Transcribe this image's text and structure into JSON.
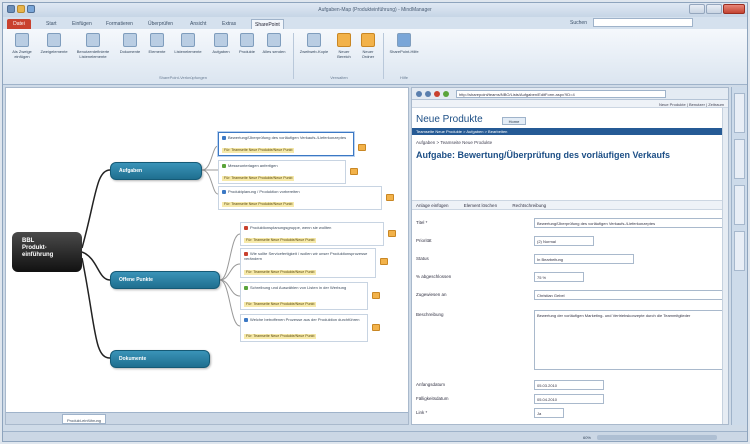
{
  "titlebar": {
    "title": "Aufgaben-Map (Produkteinführung) - MindManager"
  },
  "ribbon_tabs": [
    "Datei",
    "Start",
    "Einfügen",
    "Formatieren",
    "Überprüfen",
    "Ansicht",
    "Extras",
    "SharePoint"
  ],
  "active_tab_index": 7,
  "search": {
    "label": "Suchen",
    "value": ""
  },
  "ribbon": {
    "buttons": [
      "Als Zweige einfügen",
      "Zweigelemente",
      "Benutzerdefinierte Listenelemente",
      "Dokumente",
      "Elemente",
      "Listenelemente",
      "Aufgaben",
      "Produkte",
      "Alles senden",
      "Zweitweb-Kopie",
      "Neuer Bereich",
      "Neuer Ordner",
      "SharePoint-Hilfe"
    ],
    "groups": [
      "SharePoint-Verknüpfungen",
      "Verwalten",
      "Hilfe"
    ]
  },
  "map": {
    "central": {
      "line1": "BBL",
      "line2": "Produkt-",
      "line3": "einführung"
    },
    "topics": [
      "Aufgaben",
      "Offene Punkte",
      "Dokumente"
    ],
    "tasks": [
      {
        "text": "Bewertung/Überprüfung des vorläufigen Verkaufs-/Lieferkonzeptes",
        "tag": "Für: Teamseite Neue Produkte/Neue Punkt",
        "color": "#3b78c4"
      },
      {
        "text": "Messeunterlagen anfertigen",
        "tag": "Für: Teamseite Neue Produkte/Neue Punkt",
        "color": "#5aa43a"
      },
      {
        "text": "Produktplanung / Produktion vorbereiten",
        "tag": "Für: Teamseite Neue Produkte/Neue Punkt",
        "color": "#3b78c4"
      },
      {
        "text": "Produktionsplanungsgruppe, wenn sie wollten",
        "tag": "Für: Teamseite Neue Produkte/Neue Punkt",
        "color": "#c9412e"
      },
      {
        "text": "Wie sollte Servicefertigkeit / wollen wir unser Produktionsprozesse verändern",
        "tag": "Für: Teamseite Neue Produkte/Neue Punkt",
        "color": "#c9412e"
      },
      {
        "text": "Schreibung und Auswählen von Listen in der Werbung",
        "tag": "Für: Teamseite Neue Produkte/Neue Punkt",
        "color": "#5aa43a"
      },
      {
        "text": "Welche betroffenen Prozesse aus der Produktion durchführen",
        "tag": "Für: Teamseite Neue Produkte/Neue Punkt",
        "color": "#3b78c4"
      }
    ]
  },
  "status": {
    "doc_tab": "Produkt-einführung",
    "zoom": "60%"
  },
  "browser": {
    "url": "http://sharepoint/teams/NBO/Lists/Aufgaben/EditForm.aspx?ID=4",
    "bar2": "Neue Produkte | Benutzer | Zeitraum",
    "site_title": "Neue Produkte",
    "site_tab": "Home",
    "blue_bar": "Teamseite Neue Produkte > Aufgaben > Bearbeiten",
    "breadcrumb": "Aufgaben > Teamseite Neue Produkte",
    "heading_prefix": "Aufgabe:",
    "heading": "Bewertung/Überprüfung des vorläufigen Verkaufs",
    "toolbar": [
      "Anlage einfügen",
      "Element löschen",
      "Rechtschreibung"
    ],
    "fields": [
      {
        "label": "Titel *",
        "value": "Bewertung/Überprüfung des vorläufigen Verkaufs-/Lieferkonzeptes"
      },
      {
        "label": "Priorität",
        "value": "(2) Normal"
      },
      {
        "label": "Status",
        "value": "In Bearbeitung"
      },
      {
        "label": "% abgeschlossen",
        "value": "75 %"
      },
      {
        "label": "Zugewiesen an",
        "value": "Christian Gebel"
      },
      {
        "label": "Beschreibung",
        "value": "Bewertung der vorläufigen Marketing- und Vertriebskonzepte durch die Teammitglieder"
      },
      {
        "label": "Anfangsdatum",
        "value": "05.03.2010"
      },
      {
        "label": "Fälligkeitsdatum",
        "value": "05.04.2010"
      },
      {
        "label": "Link *",
        "value": "Ja"
      }
    ]
  },
  "colors": {
    "accent": "#1f6f8f",
    "central": "#111111",
    "file_tab": "#c9412e"
  }
}
